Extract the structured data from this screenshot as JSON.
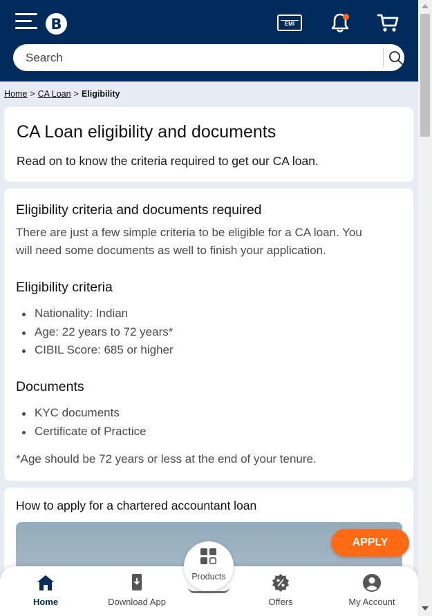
{
  "header": {
    "logo_letter": "B",
    "emi_label": "EMI",
    "search_placeholder": "Search"
  },
  "colors": {
    "brand_navy": "#002b5c",
    "accent_orange": "#ff6a13"
  },
  "breadcrumb": {
    "items": [
      "Home",
      "CA Loan",
      "Eligibility"
    ],
    "separator": ">"
  },
  "hero": {
    "title": "CA Loan eligibility and documents",
    "subtitle": "Read on to know the criteria required to get our CA loan."
  },
  "eligibility": {
    "heading": "Eligibility criteria and documents required",
    "intro_line1": "There are just a few simple criteria to be eligible for a CA loan. You",
    "intro_line2": "will need some documents as well to finish your application.",
    "criteria_heading": "Eligibility criteria",
    "criteria": [
      "Nationality: Indian",
      "Age: 22 years to 72 years*",
      "CIBIL Score: 685 or higher"
    ],
    "documents_heading": "Documents",
    "documents": [
      "KYC documents",
      "Certificate of Practice"
    ],
    "footnote": "*Age should be 72 years or less at the end of your tenure."
  },
  "how_to_apply": {
    "heading": "How to apply for a chartered accountant loan"
  },
  "apply_button": "APPLY",
  "bottom_nav": {
    "home": "Home",
    "download": "Download App",
    "products": "Products",
    "offers": "Offers",
    "account": "My Account"
  },
  "icons": [
    "menu-icon",
    "emi-calculator-icon",
    "bell-icon",
    "cart-icon",
    "search-icon",
    "home-icon",
    "download-app-icon",
    "products-grid-icon",
    "offers-icon",
    "account-icon"
  ]
}
